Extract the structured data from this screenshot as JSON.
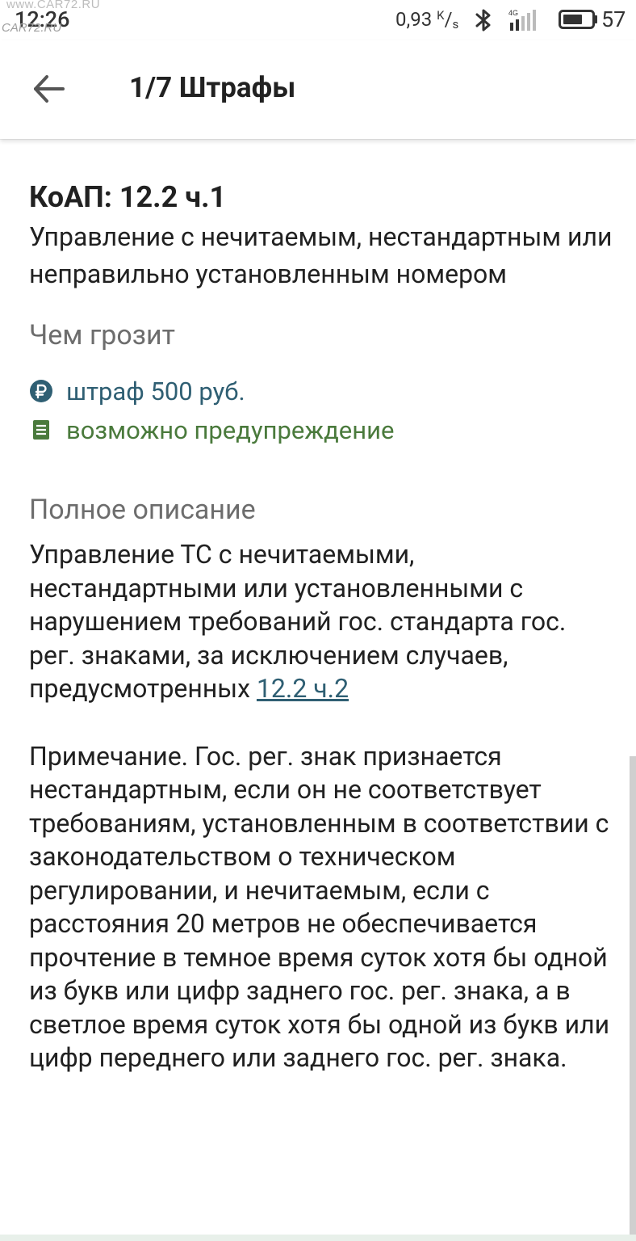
{
  "status_bar": {
    "watermark_text": "www.CAR72.RU",
    "watermark_logo": "CAR72.RU",
    "time": "12:26",
    "net_speed_value": "0,93",
    "net_speed_unit_top": "K",
    "net_speed_unit_bottom": "s",
    "network_type": "4G",
    "battery_level": "57",
    "icons": [
      "bluetooth-icon",
      "signal-icon",
      "battery-icon"
    ]
  },
  "app_bar": {
    "back_icon": "arrow-back-icon",
    "title": "1/7 Штрафы"
  },
  "article": {
    "code": "КоАП: 12.2 ч.1",
    "title": "Управление с нечитаемым, нестандартным или неправильно установленным номером"
  },
  "threat": {
    "heading": "Чем грозит",
    "items": [
      {
        "icon": "ruble-icon",
        "text": "штраф 500 руб.",
        "color": "#2f5f73"
      },
      {
        "icon": "document-icon",
        "text": "возможно предупреждение",
        "color": "#4a7a3c"
      }
    ]
  },
  "description": {
    "heading": "Полное описание",
    "text": "Управление ТС с нечитаемыми, нестандартными или установленными с нарушением требований гос. стандарта гос. рег. знаками, за исключением случаев, предусмотренных",
    "link_text": "12.2 ч.2",
    "note": "Примечание. Гос. рег. знак признается нестандартным, если он не соответствует требованиям, установленным в соответствии с законодательством о техническом регулировании, и нечитаемым, если с расстояния 20 метров не обеспечивается прочтение в темное время суток хотя бы одной из букв или цифр заднего гос. рег. знака, а в светлое время суток хотя бы одной из букв или цифр переднего или заднего гос. рег. знака."
  },
  "colors": {
    "accent_link": "#2f5f73",
    "warning_green": "#4a7a3c",
    "heading_gray": "#6d6d6d",
    "text": "#212121"
  }
}
